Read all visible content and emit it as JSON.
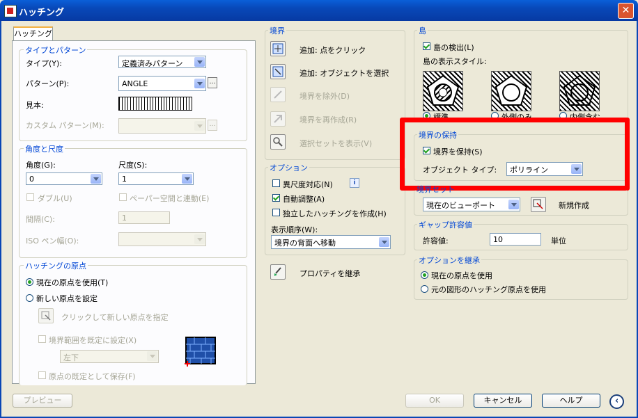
{
  "window": {
    "title": "ハッチング"
  },
  "tabs": {
    "hatch": "ハッチング"
  },
  "type_pattern": {
    "title": "タイプとパターン",
    "type_label": "タイプ(Y):",
    "type_value": "定義済みパターン",
    "pattern_label": "パターン(P):",
    "pattern_value": "ANGLE",
    "swatch_label": "見本:",
    "custom_label": "カスタム パターン(M):"
  },
  "angle_scale": {
    "title": "角度と尺度",
    "angle_label": "角度(G):",
    "angle_value": "0",
    "scale_label": "尺度(S):",
    "scale_value": "1",
    "double_label": "ダブル(U)",
    "paper_label": "ペーパー空間と連動(E)",
    "spacing_label": "間隔(C):",
    "spacing_value": "1",
    "iso_label": "ISO ペン幅(O):"
  },
  "origin": {
    "title": "ハッチングの原点",
    "current_label": "現在の原点を使用(T)",
    "new_label": "新しい原点を設定",
    "click_label": "クリックして新しい原点を指定",
    "default_extent_label": "境界範囲を既定に設定(X)",
    "corner_value": "左下",
    "store_label": "原点の既定として保存(F)"
  },
  "boundary": {
    "title": "境界",
    "add_pick": "追加: 点をクリック",
    "add_select": "追加: オブジェクトを選択",
    "remove": "境界を除外(D)",
    "recreate": "境界を再作成(R)",
    "view_sel": "選択セットを表示(V)"
  },
  "options": {
    "title": "オプション",
    "annotative": "異尺度対応(N)",
    "associative": "自動調整(A)",
    "separate": "独立したハッチングを作成(H)",
    "draw_order_label": "表示順序(W):",
    "draw_order_value": "境界の背面へ移動",
    "inherit": "プロパティを継承",
    "info_icon": "i"
  },
  "islands": {
    "title": "島",
    "detect": "島の検出(L)",
    "style_label": "島の表示スタイル:",
    "styles": [
      "標準",
      "外側のみ",
      "内側含む"
    ]
  },
  "retain": {
    "title": "境界の保持",
    "retain_label": "境界を保持(S)",
    "object_type_label": "オブジェクト タイプ:",
    "object_type_value": "ポリライン"
  },
  "boundary_set": {
    "title": "境界セット",
    "value": "現在のビューポート",
    "new_label": "新規作成"
  },
  "gap": {
    "title": "ギャップ許容値",
    "label": "許容値:",
    "value": "10",
    "unit": "単位"
  },
  "inherit_options": {
    "title": "オプションを継承",
    "current": "現在の原点を使用",
    "source": "元の図形のハッチング原点を使用"
  },
  "footer": {
    "preview": "プレビュー",
    "ok": "OK",
    "cancel": "キャンセル",
    "help": "ヘルプ",
    "more_icon": "‹"
  }
}
